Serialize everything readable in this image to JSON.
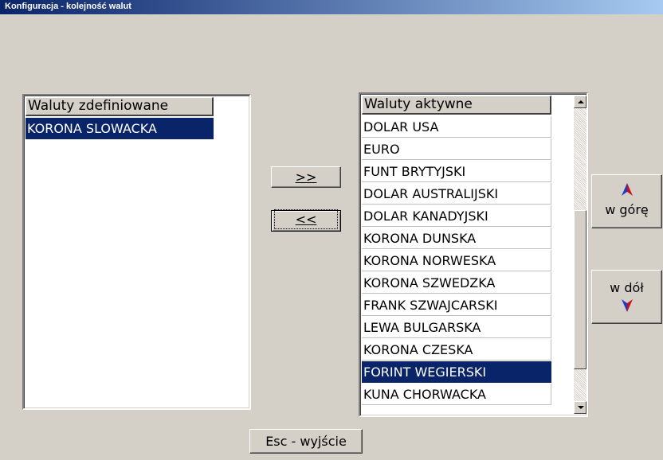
{
  "window": {
    "title": "Konfiguracja - kolejność walut"
  },
  "defined_list": {
    "header": "Waluty zdefiniowane",
    "items": [
      "KORONA SLOWACKA"
    ],
    "selected_index": 0
  },
  "active_list": {
    "header": "Waluty aktywne",
    "items": [
      "DOLAR USA",
      "EURO",
      "FUNT BRYTYJSKI",
      "DOLAR AUSTRALIJSKI",
      "DOLAR KANADYJSKI",
      "KORONA DUNSKA",
      "KORONA NORWESKA",
      "KORONA SZWEDZKA",
      "FRANK SZWAJCARSKI",
      "LEWA BULGARSKA",
      "KORONA CZESKA",
      "FORINT WEGIERSKI",
      "KUNA CHORWACKA"
    ],
    "selected_index": 11
  },
  "buttons": {
    "add": ">>",
    "remove": "<<",
    "up": "w górę",
    "down": "w dół",
    "exit": "Esc - wyjście"
  },
  "icons": {
    "up": "arrow-up-icon",
    "down": "arrow-down-icon"
  },
  "colors": {
    "selection": "#0a246a",
    "arrow_blue": "#1a3ccc",
    "arrow_red": "#cc1010"
  }
}
